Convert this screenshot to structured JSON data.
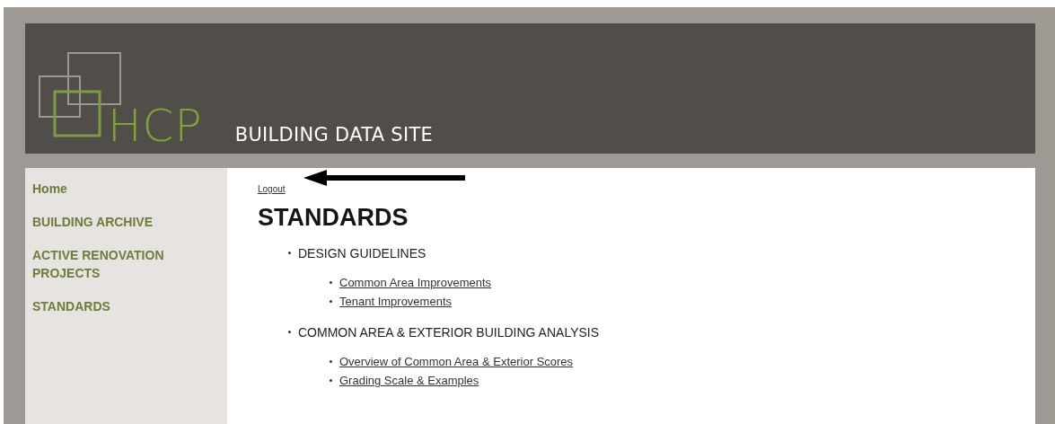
{
  "header": {
    "logo_text": "HCP",
    "title": "BUILDING DATA SITE"
  },
  "sidebar": {
    "items": [
      {
        "label": "Home"
      },
      {
        "label": "BUILDING ARCHIVE"
      },
      {
        "label": "ACTIVE RENOVATION PROJECTS"
      },
      {
        "label": "STANDARDS"
      }
    ]
  },
  "content": {
    "logout": "Logout",
    "heading": "STANDARDS",
    "annotation": {
      "kind": "arrow"
    },
    "sections": [
      {
        "title": "DESIGN GUIDELINES",
        "links": [
          "Common Area Improvements",
          "Tenant Improvements"
        ]
      },
      {
        "title": "COMMON AREA & EXTERIOR BUILDING ANALYSIS",
        "links": [
          "Overview of Common Area & Exterior Scores",
          "Grading Scale & Examples"
        ]
      }
    ]
  }
}
